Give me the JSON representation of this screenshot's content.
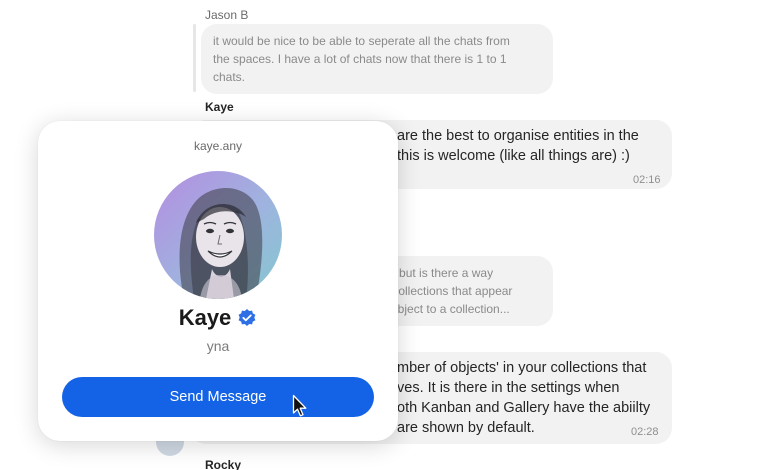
{
  "messages": [
    {
      "author": "Jason B",
      "reply_lines": [
        "it would be nice to be able to seperate all the chats from",
        "the spaces. I have a lot of chats now that there is 1 to 1",
        "chats."
      ]
    },
    {
      "author": "Kaye",
      "lines": [
        "are the best to organise entities in the",
        "this is welcome (like all things are) :)"
      ],
      "time": "02:16"
    },
    {
      "reply_lines": [
        "on, but is there a way",
        "of collections that appear",
        "w object to a collection..."
      ]
    },
    {
      "lines": [
        "mber of objects' in your collections that",
        "ves. It is there in the settings when",
        "oth Kanban and Gallery have the abiilty",
        "are shown by default."
      ],
      "time": "02:28"
    }
  ],
  "partial_author": "Rocky",
  "profile": {
    "username": "kaye.any",
    "name": "Kaye",
    "description": "yna",
    "send_label": "Send Message",
    "accent": "#1463e6"
  }
}
